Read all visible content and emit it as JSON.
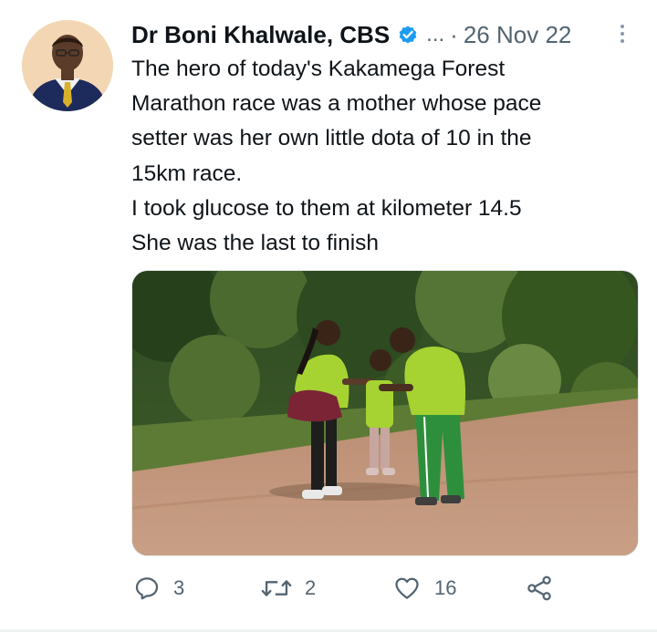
{
  "author": {
    "display_name": "Dr Boni Khalwale, CBS",
    "verified": true,
    "avatar_icon": "profile-photo",
    "truncation": "...",
    "separator": "·",
    "date": "26 Nov 22"
  },
  "tweet": {
    "lines": [
      "The hero of today's Kakamega Forest",
      "Marathon race was a mother whose pace",
      "setter was her own little dota of 10 in the",
      "15km race.",
      "I took glucose to them at kilometer 14.5",
      "She was the last to finish"
    ]
  },
  "media": {
    "type": "photo",
    "scene": "forest-dirt-road-runners"
  },
  "actions": {
    "reply_count": "3",
    "retweet_count": "2",
    "like_count": "16",
    "icons": [
      "reply-icon",
      "retweet-icon",
      "like-icon",
      "share-icon"
    ]
  },
  "colors": {
    "verified_blue": "#1d9bf0",
    "muted_text": "#536471",
    "primary_text": "#0f1419"
  }
}
